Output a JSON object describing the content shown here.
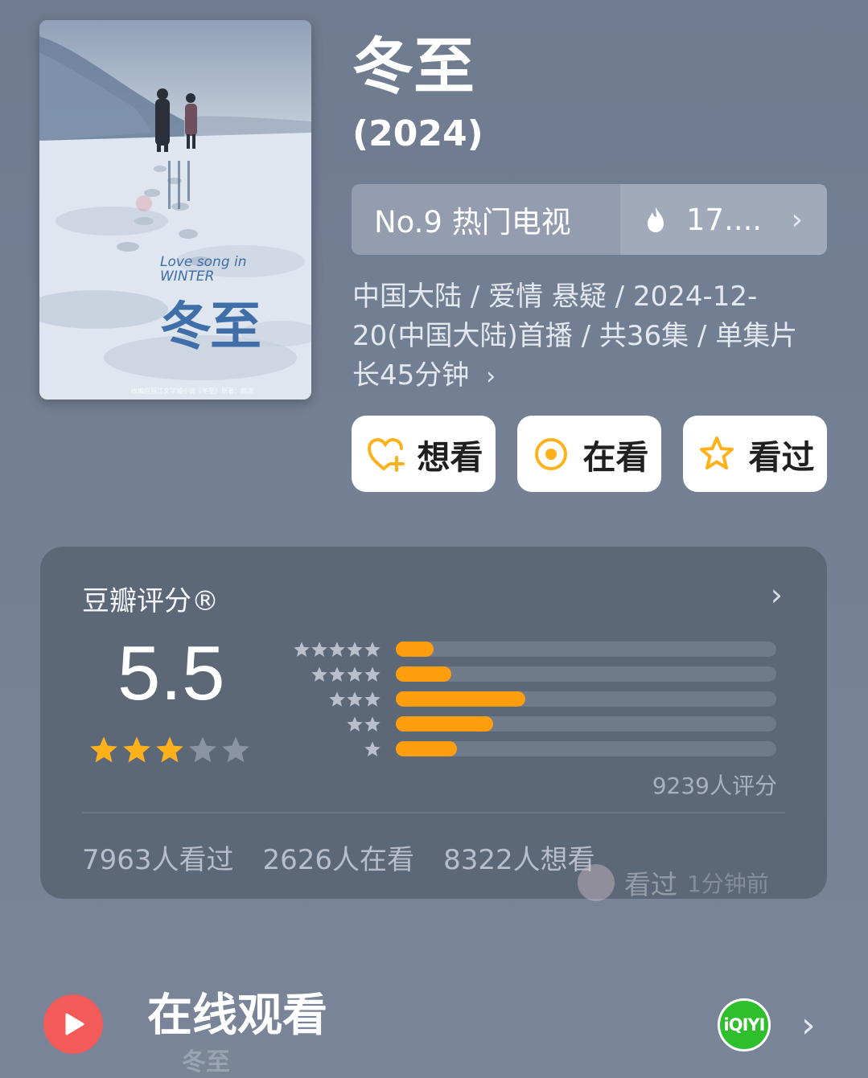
{
  "show": {
    "title": "冬至",
    "year": "(2024)",
    "poster": {
      "title": "冬至",
      "english_title": "Love song in WINTER",
      "credit": "改编自晋江文学城小说《冬至》原著：颜凉"
    }
  },
  "ranking": {
    "label": "No.9 热门电视",
    "heat": "17....",
    "icon": "flame-icon"
  },
  "meta": {
    "text": "中国大陆 / 爱情 悬疑 / 2024-12-20(中国大陆)首播 / 共36集 / 单集片长45分钟",
    "chevron": "›"
  },
  "actions": [
    {
      "label": "想看",
      "icon": "heart-plus-icon"
    },
    {
      "label": "在看",
      "icon": "target-icon"
    },
    {
      "label": "看过",
      "icon": "star-outline-icon"
    }
  ],
  "rating": {
    "header": "豆瓣评分®",
    "arrow": "›",
    "score": "5.5",
    "score_stars": 2.75,
    "distribution": [
      {
        "stars": 5,
        "fraction": 0.1
      },
      {
        "stars": 4,
        "fraction": 0.145
      },
      {
        "stars": 3,
        "fraction": 0.34
      },
      {
        "stars": 2,
        "fraction": 0.255
      },
      {
        "stars": 1,
        "fraction": 0.16
      }
    ],
    "count": "9239人评分",
    "stats": {
      "watched": "7963人看过",
      "watching": "2626人在看",
      "want": "8322人想看"
    },
    "overlay": {
      "action": "看过",
      "time": "1分钟前"
    }
  },
  "watch": {
    "title": "在线观看",
    "platform": "iQIYI",
    "arrow": "›",
    "faint_text": "冬至"
  },
  "colors": {
    "accent_orange": "#ff9e0c",
    "star_gold": "#ffb11b",
    "play_red": "#f35b5b",
    "iqiyi_green": "#2fbf2c"
  }
}
